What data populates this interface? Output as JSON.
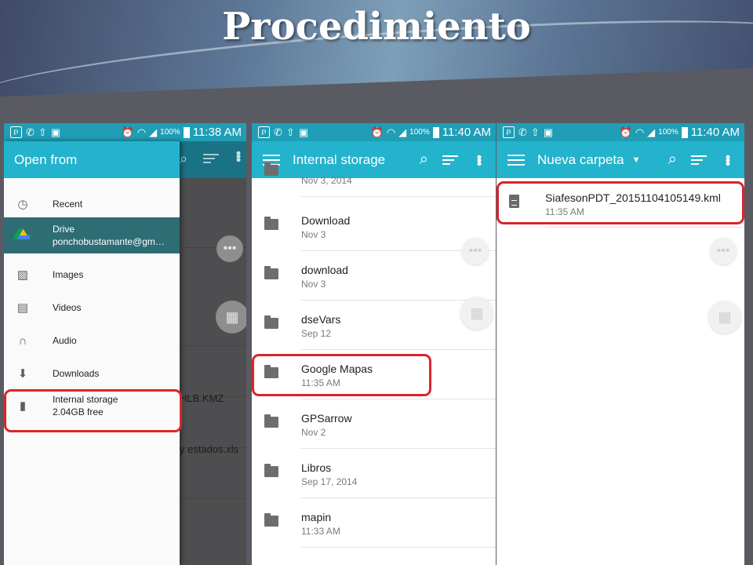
{
  "slide": {
    "title": "Procedimiento"
  },
  "status": {
    "battery": "100%",
    "time_1": "11:38 AM",
    "time_2": "11:40 AM",
    "time_3": "11:40 AM",
    "icon_p": "P"
  },
  "screen1": {
    "drawer_title": "Open from",
    "items": [
      {
        "label": "Recent",
        "icon": "clock-icon"
      },
      {
        "label": "Drive",
        "sub": "ponchobustamante@gm…",
        "icon": "google-drive-icon"
      },
      {
        "label": "Images",
        "icon": "image-icon"
      },
      {
        "label": "Videos",
        "icon": "film-icon"
      },
      {
        "label": "Audio",
        "icon": "headphones-icon"
      },
      {
        "label": "Downloads",
        "icon": "download-icon"
      },
      {
        "label": "Internal storage",
        "sub": "2.04GB free",
        "icon": "sd-card-icon"
      }
    ],
    "background_items": [
      "HLB.KMZ",
      "y estados.xls"
    ]
  },
  "screen2": {
    "title": "Internal storage",
    "folders": [
      {
        "name": "",
        "date": "Nov 3, 2014"
      },
      {
        "name": "Download",
        "date": "Nov 3"
      },
      {
        "name": "download",
        "date": "Nov 3"
      },
      {
        "name": "dseVars",
        "date": "Sep 12"
      },
      {
        "name": "Google Mapas",
        "date": "11:35 AM"
      },
      {
        "name": "GPSarrow",
        "date": "Nov 2"
      },
      {
        "name": "Libros",
        "date": "Sep 17, 2014"
      },
      {
        "name": "mapin",
        "date": "11:33 AM"
      }
    ]
  },
  "screen3": {
    "title": "Nueva carpeta",
    "files": [
      {
        "name": "SiafesonPDT_20151104105149.kml",
        "date": "11:35 AM"
      }
    ]
  },
  "colors": {
    "appbar": "#23b3cc",
    "statusbar": "#1f9eb6",
    "highlight": "#d9252a",
    "selected_item": "#2f6d75"
  }
}
